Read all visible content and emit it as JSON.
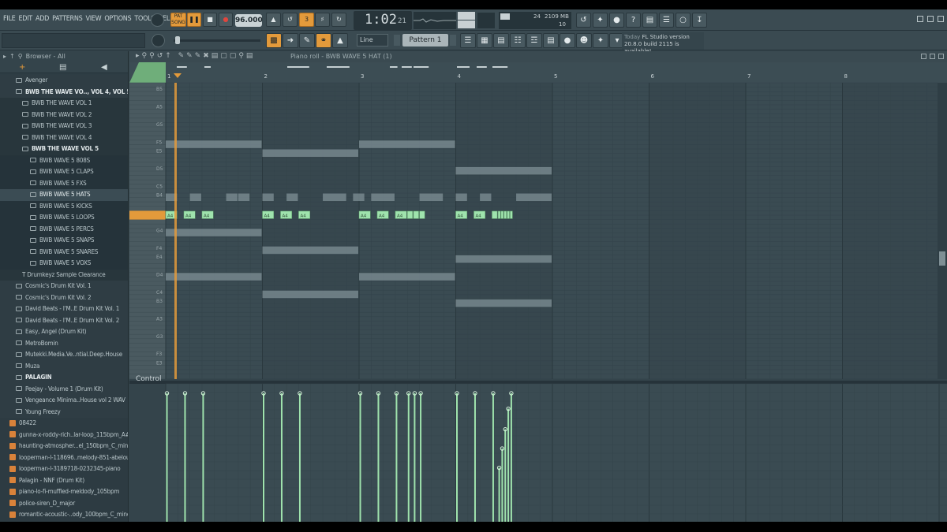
{
  "menu": [
    "FILE",
    "EDIT",
    "ADD",
    "PATTERNS",
    "VIEW",
    "OPTIONS",
    "TOOLS",
    "HELP"
  ],
  "transport": {
    "pat_label": "PAT",
    "song_label": "SONG",
    "tempo": "96.000",
    "time_main": "1:02",
    "time_sub": "21",
    "cpu_val": "24",
    "mem_val": "2109 MB",
    "poly_val": "10"
  },
  "toolbar2": {
    "snap": "Line",
    "pattern": "Pattern 1"
  },
  "news": {
    "today": "Today",
    "line1": "FL Studio version",
    "line2": "20.8.0 build 2115 is available!"
  },
  "browser": {
    "title": "Browser - All",
    "items": [
      {
        "label": "Avenger",
        "level": "l1",
        "icon": "folder-icon"
      },
      {
        "label": "BWB THE WAVE VO.., VOL 4, VOL 5",
        "level": "l1",
        "icon": "folder-open-icon",
        "state": "open"
      },
      {
        "label": "BWB THE WAVE VOL 1",
        "level": "l2",
        "icon": "folder-icon"
      },
      {
        "label": "BWB THE WAVE VOL 2",
        "level": "l2",
        "icon": "folder-icon"
      },
      {
        "label": "BWB THE WAVE VOL 3",
        "level": "l2",
        "icon": "folder-icon"
      },
      {
        "label": "BWB THE WAVE VOL 4",
        "level": "l2",
        "icon": "folder-icon"
      },
      {
        "label": "BWB THE WAVE VOL 5",
        "level": "l2",
        "icon": "folder-open-icon",
        "state": "open"
      },
      {
        "label": "BWB WAVE 5 808S",
        "level": "l3",
        "icon": "folder-icon"
      },
      {
        "label": "BWB WAVE 5 CLAPS",
        "level": "l3",
        "icon": "folder-icon"
      },
      {
        "label": "BWB WAVE 5 FXS",
        "level": "l3",
        "icon": "folder-icon"
      },
      {
        "label": "BWB WAVE 5 HATS",
        "level": "l3",
        "icon": "folder-icon",
        "state": "sel"
      },
      {
        "label": "BWB WAVE 5 KICKS",
        "level": "l3",
        "icon": "folder-icon"
      },
      {
        "label": "BWB WAVE 5 LOOPS",
        "level": "l3",
        "icon": "folder-icon"
      },
      {
        "label": "BWB WAVE 5 PERCS",
        "level": "l3",
        "icon": "folder-icon"
      },
      {
        "label": "BWB WAVE 5 SNAPS",
        "level": "l3",
        "icon": "folder-icon"
      },
      {
        "label": "BWB WAVE 5 SNARES",
        "level": "l3",
        "icon": "folder-icon"
      },
      {
        "label": "BWB WAVE 5 VOXS",
        "level": "l3",
        "icon": "folder-icon"
      },
      {
        "label": "Drumkeyz Sample Clearance",
        "level": "l2",
        "icon": "text-icon"
      },
      {
        "label": "Cosmic's Drum Kit Vol. 1",
        "level": "l1",
        "icon": "folder-icon"
      },
      {
        "label": "Cosmic's Drum Kit Vol. 2",
        "level": "l1",
        "icon": "folder-icon"
      },
      {
        "label": "David Beats - I'M..E Drum Kit Vol. 1",
        "level": "l1",
        "icon": "folder-icon"
      },
      {
        "label": "David Beats - I'M..E Drum Kit Vol. 2",
        "level": "l1",
        "icon": "folder-icon"
      },
      {
        "label": "Easy, Angel (Drum Kit)",
        "level": "l1",
        "icon": "folder-icon"
      },
      {
        "label": "MetroBomin",
        "level": "l1",
        "icon": "folder-icon"
      },
      {
        "label": "Mutekki.Media.Ve..ntial.Deep.House",
        "level": "l1",
        "icon": "folder-icon"
      },
      {
        "label": "Muza",
        "level": "l1",
        "icon": "folder-icon"
      },
      {
        "label": "PALAGIN",
        "level": "l1",
        "icon": "folder-icon",
        "state": "bold"
      },
      {
        "label": "Peejay - Volume 1 (Drum Kit)",
        "level": "l1",
        "icon": "folder-icon"
      },
      {
        "label": "Vengeance Minima..House vol 2 WAV",
        "level": "l1",
        "icon": "folder-icon"
      },
      {
        "label": "Young Freezy",
        "level": "l1",
        "icon": "folder-icon"
      },
      {
        "label": "08422",
        "level": "file",
        "icon": "audio-file-icon"
      },
      {
        "label": "gunna-x-roddy-rich..lar-loop_115bpm_A#",
        "level": "file",
        "icon": "audio-file-icon"
      },
      {
        "label": "haunting-atmospher...el_150bpm_C_minor",
        "level": "file",
        "icon": "audio-file-icon"
      },
      {
        "label": "looperman-l-118696..melody-851-abelouis",
        "level": "file",
        "icon": "audio-file-icon"
      },
      {
        "label": "looperman-l-3189718-0232345-piano",
        "level": "file",
        "icon": "audio-file-icon"
      },
      {
        "label": "Palagin - NNF (Drum Kit)",
        "level": "file",
        "icon": "archive-icon"
      },
      {
        "label": "piano-lo-fi-muffled-meldody_105bpm",
        "level": "file",
        "icon": "audio-file-icon"
      },
      {
        "label": "police-siren_D_major",
        "level": "file",
        "icon": "audio-file-icon"
      },
      {
        "label": "romantic-acoustic-..ody_100bpm_C_minor",
        "level": "file",
        "icon": "audio-file-icon"
      },
      {
        "label": "smooth-quiet-melo..here_90bpm_C_minor",
        "level": "file",
        "icon": "audio-file-icon"
      }
    ]
  },
  "piano_roll": {
    "title": "Piano roll - BWB WAVE 5 HAT (1)",
    "bars": [
      "1",
      "2",
      "3",
      "4",
      "5",
      "6",
      "7",
      "8"
    ],
    "keys": [
      "B5",
      "A5",
      "G5",
      "F5",
      "E5",
      "D5",
      "C5",
      "B4",
      "A4",
      "G4",
      "F4",
      "E4",
      "D4",
      "C4",
      "B3",
      "A3",
      "G3",
      "F3",
      "E3"
    ],
    "highlight_key": "A4",
    "note_label": "A4",
    "control_label": "Control",
    "accent_color": "#e39a3b",
    "note_color": "#9fe3ad",
    "ghost_color": "#7f8f95",
    "notes_a4": [
      {
        "start": 0.0,
        "len": 0.125
      },
      {
        "start": 0.1875,
        "len": 0.125
      },
      {
        "start": 0.375,
        "len": 0.125
      },
      {
        "start": 1.0,
        "len": 0.125
      },
      {
        "start": 1.1875,
        "len": 0.125
      },
      {
        "start": 1.375,
        "len": 0.125
      },
      {
        "start": 2.0,
        "len": 0.125
      },
      {
        "start": 2.1875,
        "len": 0.125
      },
      {
        "start": 2.375,
        "len": 0.125
      },
      {
        "start": 2.5,
        "len": 0.0625
      },
      {
        "start": 2.5625,
        "len": 0.0625
      },
      {
        "start": 2.625,
        "len": 0.0625
      },
      {
        "start": 3.0,
        "len": 0.125
      },
      {
        "start": 3.1875,
        "len": 0.125
      },
      {
        "start": 3.375,
        "len": 0.0625
      },
      {
        "start": 3.4375,
        "len": 0.03125
      },
      {
        "start": 3.46875,
        "len": 0.03125
      },
      {
        "start": 3.5,
        "len": 0.03125
      },
      {
        "start": 3.53125,
        "len": 0.03125
      },
      {
        "start": 3.5625,
        "len": 0.03125
      }
    ],
    "ghost_notes": [
      {
        "key": "F5",
        "start": 0.0,
        "len": 1.0
      },
      {
        "key": "E5",
        "start": 1.0,
        "len": 1.0
      },
      {
        "key": "F5",
        "start": 2.0,
        "len": 1.0
      },
      {
        "key": "D5",
        "start": 3.0,
        "len": 1.0
      },
      {
        "key": "G4",
        "start": 0.0,
        "len": 1.0
      },
      {
        "key": "F4",
        "start": 1.0,
        "len": 1.0
      },
      {
        "key": "E4",
        "start": 3.0,
        "len": 1.0
      },
      {
        "key": "D4",
        "start": 0.0,
        "len": 1.0
      },
      {
        "key": "D4",
        "start": 2.0,
        "len": 1.0
      },
      {
        "key": "C4",
        "start": 1.0,
        "len": 1.0
      },
      {
        "key": "B3",
        "start": 3.0,
        "len": 1.0
      },
      {
        "key": "B4",
        "start": 0.0,
        "len": 0.125
      },
      {
        "key": "B4",
        "start": 0.25,
        "len": 0.125
      },
      {
        "key": "B4",
        "start": 0.625,
        "len": 0.125
      },
      {
        "key": "B4",
        "start": 0.75,
        "len": 0.125
      },
      {
        "key": "B4",
        "start": 1.0,
        "len": 0.125
      },
      {
        "key": "B4",
        "start": 1.25,
        "len": 0.125
      },
      {
        "key": "B4",
        "start": 1.625,
        "len": 0.25
      },
      {
        "key": "B4",
        "start": 1.9375,
        "len": 0.125
      },
      {
        "key": "B4",
        "start": 2.125,
        "len": 0.25
      },
      {
        "key": "B4",
        "start": 2.625,
        "len": 0.25
      },
      {
        "key": "B4",
        "start": 3.0,
        "len": 0.125
      },
      {
        "key": "B4",
        "start": 3.25,
        "len": 0.125
      },
      {
        "key": "B4",
        "start": 3.625,
        "len": 0.375
      }
    ],
    "velocities": [
      1.0,
      1.0,
      1.0,
      1.0,
      1.0,
      1.0,
      1.0,
      1.0,
      1.0,
      1.0,
      1.0,
      1.0,
      1.0,
      1.0,
      1.0,
      0.42,
      0.57,
      0.72,
      0.88,
      1.0
    ]
  }
}
